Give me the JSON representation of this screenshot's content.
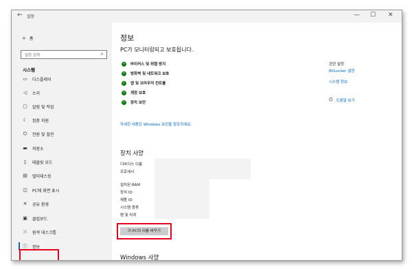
{
  "window": {
    "title": "설정",
    "back_glyph": "←",
    "min_glyph": "—",
    "max_glyph": "☐",
    "close_glyph": "✕"
  },
  "sidebar": {
    "home": {
      "label": "홈",
      "icon": "home-icon"
    },
    "search_placeholder": "설정 검색",
    "section": "시스템",
    "items": [
      {
        "label": "디스플레이",
        "icon": "display-icon"
      },
      {
        "label": "소리",
        "icon": "speaker-icon"
      },
      {
        "label": "알림 및 작업",
        "icon": "notification-icon"
      },
      {
        "label": "집중 지원",
        "icon": "moon-icon"
      },
      {
        "label": "전원 및 절전",
        "icon": "power-icon"
      },
      {
        "label": "저장소",
        "icon": "storage-icon"
      },
      {
        "label": "태블릿 모드",
        "icon": "tablet-icon"
      },
      {
        "label": "멀티태스킹",
        "icon": "multitask-icon"
      },
      {
        "label": "PC에 화면 표시",
        "icon": "project-icon"
      },
      {
        "label": "공유 환경",
        "icon": "share-icon"
      },
      {
        "label": "클립보드",
        "icon": "clipboard-icon"
      },
      {
        "label": "원격 데스크톱",
        "icon": "remote-icon"
      },
      {
        "label": "정보",
        "icon": "info-icon",
        "active": true
      }
    ]
  },
  "main": {
    "title": "정보",
    "protection_heading": "PC가 모니터링되고 보호됩니다.",
    "protection_items": [
      "바이러스 및 위협 방지",
      "방화벽 및 네트워크 보호",
      "앱 및 브라우저 컨트롤",
      "계정 보호",
      "장치 보안"
    ],
    "security_link": "자세한 내용은 Windows 보안을 참조하세요.",
    "device_specs_heading": "장치 사양",
    "spec_labels_1": [
      "디바이스 이름",
      "프로세서"
    ],
    "spec_labels_2": [
      "설치된 RAM",
      "장치 ID",
      "제품 ID",
      "시스템 종류",
      "펜 및 터치"
    ],
    "rename_button": "이 PC의 이름 바꾸기",
    "windows_specs_heading": "Windows 사양"
  },
  "right": {
    "related_title": "관련 설정",
    "bitlocker": "BitLocker 설정",
    "system_info": "시스템 정보",
    "help": "도움말 보기"
  },
  "colors": {
    "accent": "#0067c0",
    "highlight": "#e6001f",
    "check": "#107c10"
  }
}
